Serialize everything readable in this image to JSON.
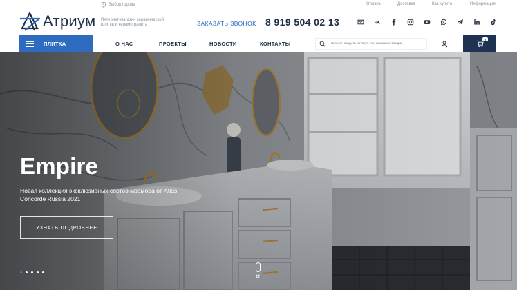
{
  "header": {
    "logo_text": "Атриум",
    "city_label": "Выбор города",
    "tagline": "Интернет-магазин керамической плитки и керамогранита",
    "callback_label": "ЗАКАЗАТЬ ЗВОНОК",
    "phone": "8 919 504 02 13",
    "top_links": [
      "Оплата",
      "Доставка",
      "Как купить",
      "Информация"
    ],
    "socials": [
      "mail-icon",
      "vk-icon",
      "facebook-icon",
      "instagram-icon",
      "youtube-icon",
      "whatsapp-icon",
      "telegram-icon",
      "linkedin-icon",
      "tiktok-icon"
    ]
  },
  "nav": {
    "catalog_label": "ПЛИТКА",
    "links": [
      "О НАС",
      "ПРОЕКТЫ",
      "НОВОСТИ",
      "КОНТАКТЫ"
    ],
    "search_placeholder": "Начните вводить артикул или название товара",
    "cart_count": "0"
  },
  "hero": {
    "title": "Empire",
    "subtitle": "Новая коллекция эксклюзивных сортов мрамора от Atlas Concorde Russia 2021",
    "button_label": "УЗНАТЬ ПОДРОБНЕЕ",
    "slides_total": 5,
    "active_slide": 1
  },
  "colors": {
    "accent": "#2d6cbf",
    "navy": "#1e3353",
    "text_dark": "#1f2f4a"
  }
}
